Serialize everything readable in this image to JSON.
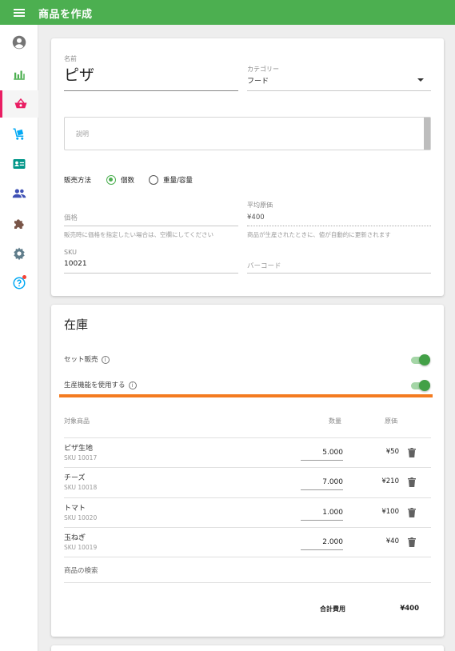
{
  "app": {
    "title": "商品を作成"
  },
  "sidebar": {
    "items": [
      {
        "icon": "account-circle-icon",
        "color": "#757575"
      },
      {
        "icon": "bar-chart-icon",
        "color": "#4caf50"
      },
      {
        "icon": "shopping-basket-icon",
        "color": "#e91e63",
        "active": true
      },
      {
        "icon": "cart-icon",
        "color": "#03a9f4"
      },
      {
        "icon": "id-card-icon",
        "color": "#009688"
      },
      {
        "icon": "people-icon",
        "color": "#3f51b5"
      },
      {
        "icon": "puzzle-icon",
        "color": "#795548"
      },
      {
        "icon": "gear-icon",
        "color": "#607d8b"
      },
      {
        "icon": "help-icon",
        "color": "#03a9f4",
        "badge": true
      }
    ]
  },
  "product": {
    "name_label": "名前",
    "name_value": "ピザ",
    "category_label": "カテゴリー",
    "category_value": "フード",
    "description_placeholder": "説明",
    "sale_method_label": "販売方法",
    "sale_options": [
      "個数",
      "重量/容量"
    ],
    "sale_selected": "個数",
    "price_placeholder": "価格",
    "price_hint": "販売時に価格を指定したい場合は、空欄にしてください",
    "avg_cost_label": "平均原価",
    "avg_cost_value": "¥400",
    "avg_cost_hint": "商品が生産されたときに、値が自動的に更新されます",
    "sku_label": "SKU",
    "sku_value": "10021",
    "barcode_placeholder": "バーコード"
  },
  "inventory": {
    "title": "在庫",
    "set_sale_label": "セット販売",
    "set_sale_on": true,
    "production_label": "生産機能を使用する",
    "production_on": true,
    "highlight_color": "#f47b20",
    "columns": {
      "item": "対象商品",
      "qty": "数量",
      "cost": "原価"
    },
    "rows": [
      {
        "name": "ピザ生地",
        "sku": "SKU 10017",
        "qty": "5.000",
        "cost": "¥50"
      },
      {
        "name": "チーズ",
        "sku": "SKU 10018",
        "qty": "7.000",
        "cost": "¥210"
      },
      {
        "name": "トマト",
        "sku": "SKU 10020",
        "qty": "1.000",
        "cost": "¥100"
      },
      {
        "name": "玉ねぎ",
        "sku": "SKU 10019",
        "qty": "2.000",
        "cost": "¥40"
      }
    ],
    "search_placeholder": "商品の検索",
    "total_label": "合計費用",
    "total_value": "¥400"
  }
}
